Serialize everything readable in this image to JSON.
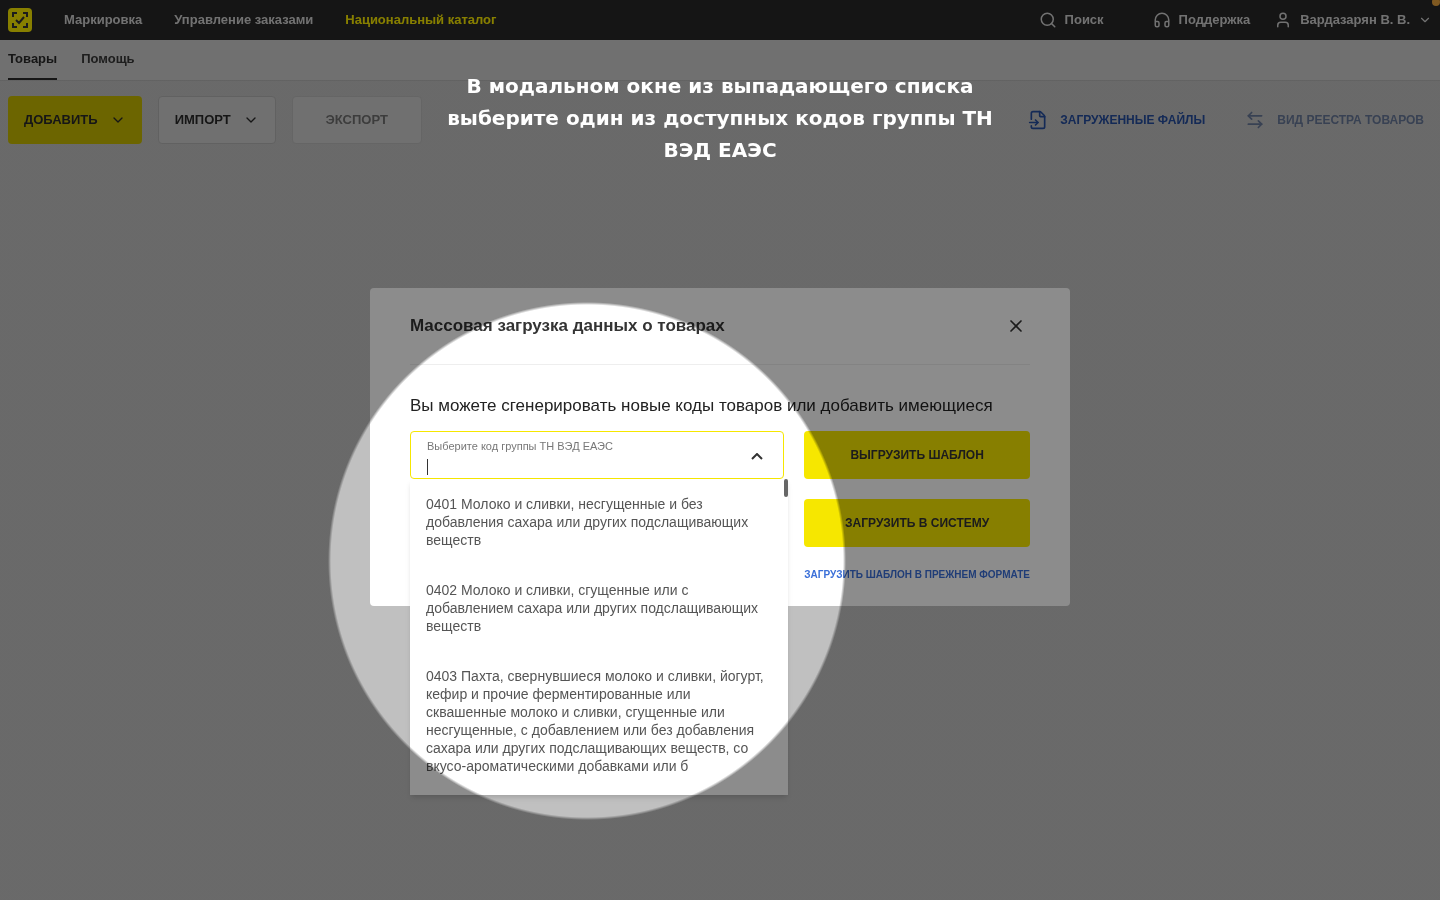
{
  "top_nav": {
    "items": [
      {
        "label": "Маркировка",
        "selected": false
      },
      {
        "label": "Управление заказами",
        "selected": false
      },
      {
        "label": "Национальный каталог",
        "selected": true
      }
    ],
    "search": {
      "placeholder": "Поиск"
    },
    "support": "Поддержка",
    "user": {
      "name": "Вардазарян В. В.",
      "notification": true
    }
  },
  "tabs": [
    {
      "label": "Товары",
      "selected": true
    },
    {
      "label": "Помощь",
      "selected": false
    }
  ],
  "toolbar": {
    "left": [
      {
        "label": "ДОБАВИТЬ",
        "kind": "primary"
      },
      {
        "label": "ИМПОРТ",
        "kind": "dropdown"
      },
      {
        "label": "ЭКСПОРТ",
        "kind": "disabled"
      }
    ],
    "right": [
      {
        "label": "ЗАГРУЖЕННЫЕ ФАЙЛЫ",
        "kind": "files",
        "disabled": false
      },
      {
        "label": "ВИД РЕЕСТРА ТОВАРОВ",
        "kind": "view",
        "disabled": true
      }
    ]
  },
  "tutorial_caption": "В модальном окне из выпадающего списка выберите один из доступных кодов группы ТН ВЭД ЕАЭС",
  "modal": {
    "title": "Массовая загрузка данных о товарах",
    "description": "Вы можете сгенерировать новые коды товаров или добавить имеющиеся",
    "select": {
      "label": "Выберите код группы ТН ВЭД ЕАЭС",
      "focused": true,
      "expanded": true,
      "options": [
        "0401 Молоко и сливки, несгущенные и без добавления сахара или других подслащивающих веществ",
        "0402 Молоко и сливки, сгущенные или с добавлением сахара или других подслащивающих веществ",
        "0403 Пахта, свернувшиеся молоко и сливки, йогурт, кефир и прочие ферментированные или сквашенные молоко и сливки, сгущенные или несгущенные, с добавлением или без добавления сахара или других подслащивающих веществ, со вкусо-ароматическими добавками или б"
      ]
    },
    "buttons": [
      "ВЫГРУЗИТЬ ШАБЛОН",
      "ЗАГРУЗИТЬ В СИСТЕМУ"
    ],
    "link": "ЗАГРУЗИТЬ ШАБЛОН В ПРЕЖНЕМ ФОРМАТЕ"
  }
}
